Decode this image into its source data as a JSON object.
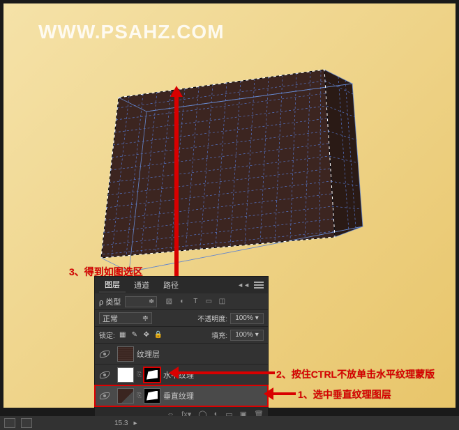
{
  "watermark": "WWW.PSAHZ.COM",
  "panel": {
    "tabs": {
      "layers": "图层",
      "channels": "通道",
      "paths": "路径"
    },
    "kind_label": "ρ 类型",
    "kind_value": "",
    "blend_mode": "正常",
    "opacity_label": "不透明度:",
    "opacity_value": "100%",
    "lock_label": "锁定:",
    "fill_label": "填充:",
    "fill_value": "100%",
    "layers": [
      {
        "name": "纹理层"
      },
      {
        "name": "水平纹理"
      },
      {
        "name": "垂直纹理"
      }
    ]
  },
  "annotations": {
    "a1": "1、选中垂直纹理图层",
    "a2": "2、按住CTRL不放单击水平纹理蒙版",
    "a3": "3、得到如图选区"
  },
  "status": {
    "zoom": "15.3"
  }
}
